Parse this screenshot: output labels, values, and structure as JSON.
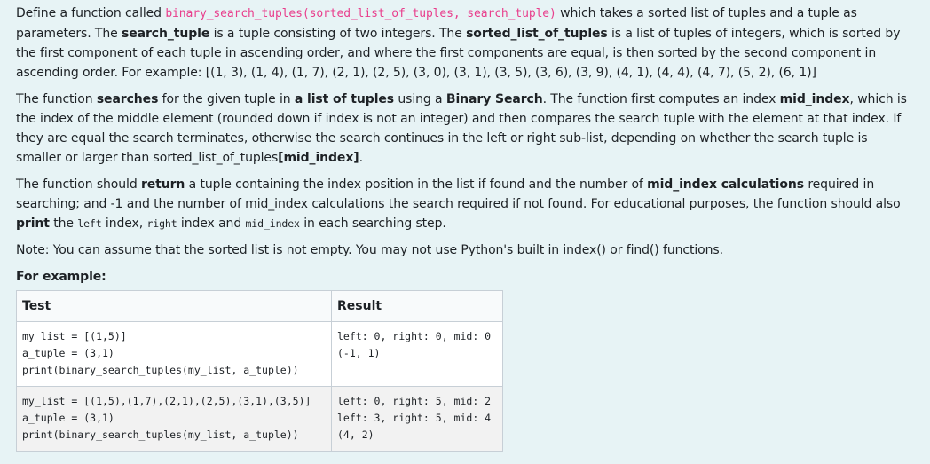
{
  "intro": {
    "p1_a": "Define a function called ",
    "p1_func": "binary_search_tuples(sorted_list_of_tuples, search_tuple)",
    "p1_b": " which takes a sorted list of tuples and a tuple as parameters. The ",
    "p1_st": "search_tuple",
    "p1_c": " is a tuple consisting of two integers. The ",
    "p1_slt": "sorted_list_of_tuples",
    "p1_d": " is a list of tuples of integers, which is sorted by the first component of each tuple in ascending order, and where the first components are equal, is then sorted by the second component in ascending order. For example: [(1, 3), (1, 4), (1, 7), (2, 1), (2, 5), (3, 0), (3, 1), (3, 5), (3, 6), (3, 9), (4, 1), (4, 4), (4, 7), (5, 2), (6, 1)]"
  },
  "search": {
    "a": "The function ",
    "b_searches": "searches",
    "c": " for the given tuple in ",
    "d_list": "a list of tuples",
    "e": " using a ",
    "f_bs": "Binary Search",
    "g": ". The function first computes an index ",
    "h_mid": "mid_index",
    "i": ", which is the index of the middle element (rounded down if index is not an integer) and then compares the search tuple with the element at that index. If they are equal the search terminates, otherwise the search continues in the left or right sub-list, depending on whether the search tuple is smaller or larger than sorted_list_of_tuples",
    "j_mid": "[mid_index]",
    "k": "."
  },
  "ret": {
    "a": "The function should ",
    "b_return": "return",
    "c": " a tuple containing the index position in the list if found and the number of ",
    "d_mid": "mid_index calculations",
    "e": " required in searching; and -1 and the number of mid_index calculations the search required if not found. For educational purposes, the function should also ",
    "f_print": "print",
    "g": " the ",
    "h_left": "left",
    "i": " index, ",
    "j_right": "right",
    "k": " index and ",
    "l_mid": "mid_index",
    "m": " in each searching step."
  },
  "note": "Note: You can assume that the sorted list is not empty. You may not use Python's built in index() or find() functions.",
  "for_example": "For example:",
  "table": {
    "headers": [
      "Test",
      "Result"
    ],
    "rows": [
      {
        "test": "my_list = [(1,5)]\na_tuple = (3,1)\nprint(binary_search_tuples(my_list, a_tuple))",
        "result": "left: 0, right: 0, mid: 0\n(-1, 1)"
      },
      {
        "test": "my_list = [(1,5),(1,7),(2,1),(2,5),(3,1),(3,5)]\na_tuple = (3,1)\nprint(binary_search_tuples(my_list, a_tuple))",
        "result": "left: 0, right: 5, mid: 2\nleft: 3, right: 5, mid: 4\n(4, 2)"
      }
    ]
  }
}
